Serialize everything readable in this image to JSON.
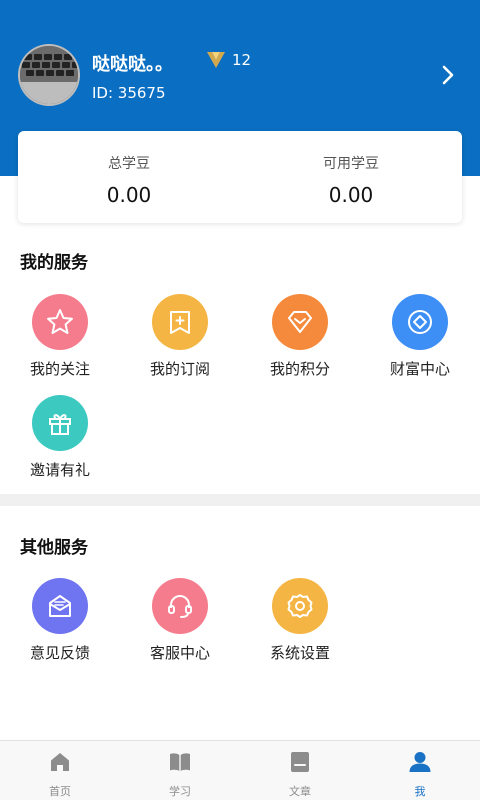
{
  "user": {
    "name": "哒哒哒。。",
    "vip_level": "12",
    "id_text": "ID: 35675"
  },
  "stats": [
    {
      "label": "总学豆",
      "value": "0.00"
    },
    {
      "label": "可用学豆",
      "value": "0.00"
    }
  ],
  "my_services": {
    "title": "我的服务",
    "items": [
      {
        "label": "我的关注",
        "icon": "star-icon",
        "color": "#f57c8c"
      },
      {
        "label": "我的订阅",
        "icon": "subscribe-icon",
        "color": "#f5b544"
      },
      {
        "label": "我的积分",
        "icon": "points-icon",
        "color": "#f58a3c"
      },
      {
        "label": "财富中心",
        "icon": "wealth-icon",
        "color": "#3d8ef5"
      },
      {
        "label": "邀请有礼",
        "icon": "gift-icon",
        "color": "#3cc9c0"
      }
    ]
  },
  "other_services": {
    "title": "其他服务",
    "items": [
      {
        "label": "意见反馈",
        "icon": "feedback-icon",
        "color": "#6f74f0"
      },
      {
        "label": "客服中心",
        "icon": "headset-icon",
        "color": "#f57c8c"
      },
      {
        "label": "系统设置",
        "icon": "settings-icon",
        "color": "#f5b544"
      }
    ]
  },
  "tabbar": {
    "items": [
      {
        "label": "首页",
        "icon": "home-icon"
      },
      {
        "label": "学习",
        "icon": "book-icon"
      },
      {
        "label": "文章",
        "icon": "article-icon"
      },
      {
        "label": "我",
        "icon": "profile-icon",
        "active": true
      }
    ],
    "active_color": "#1a72c4",
    "inactive_color": "#8c8c8c"
  },
  "colors": {
    "header_bg": "#0a6fc2",
    "vip_badge": "#d4a94e"
  }
}
